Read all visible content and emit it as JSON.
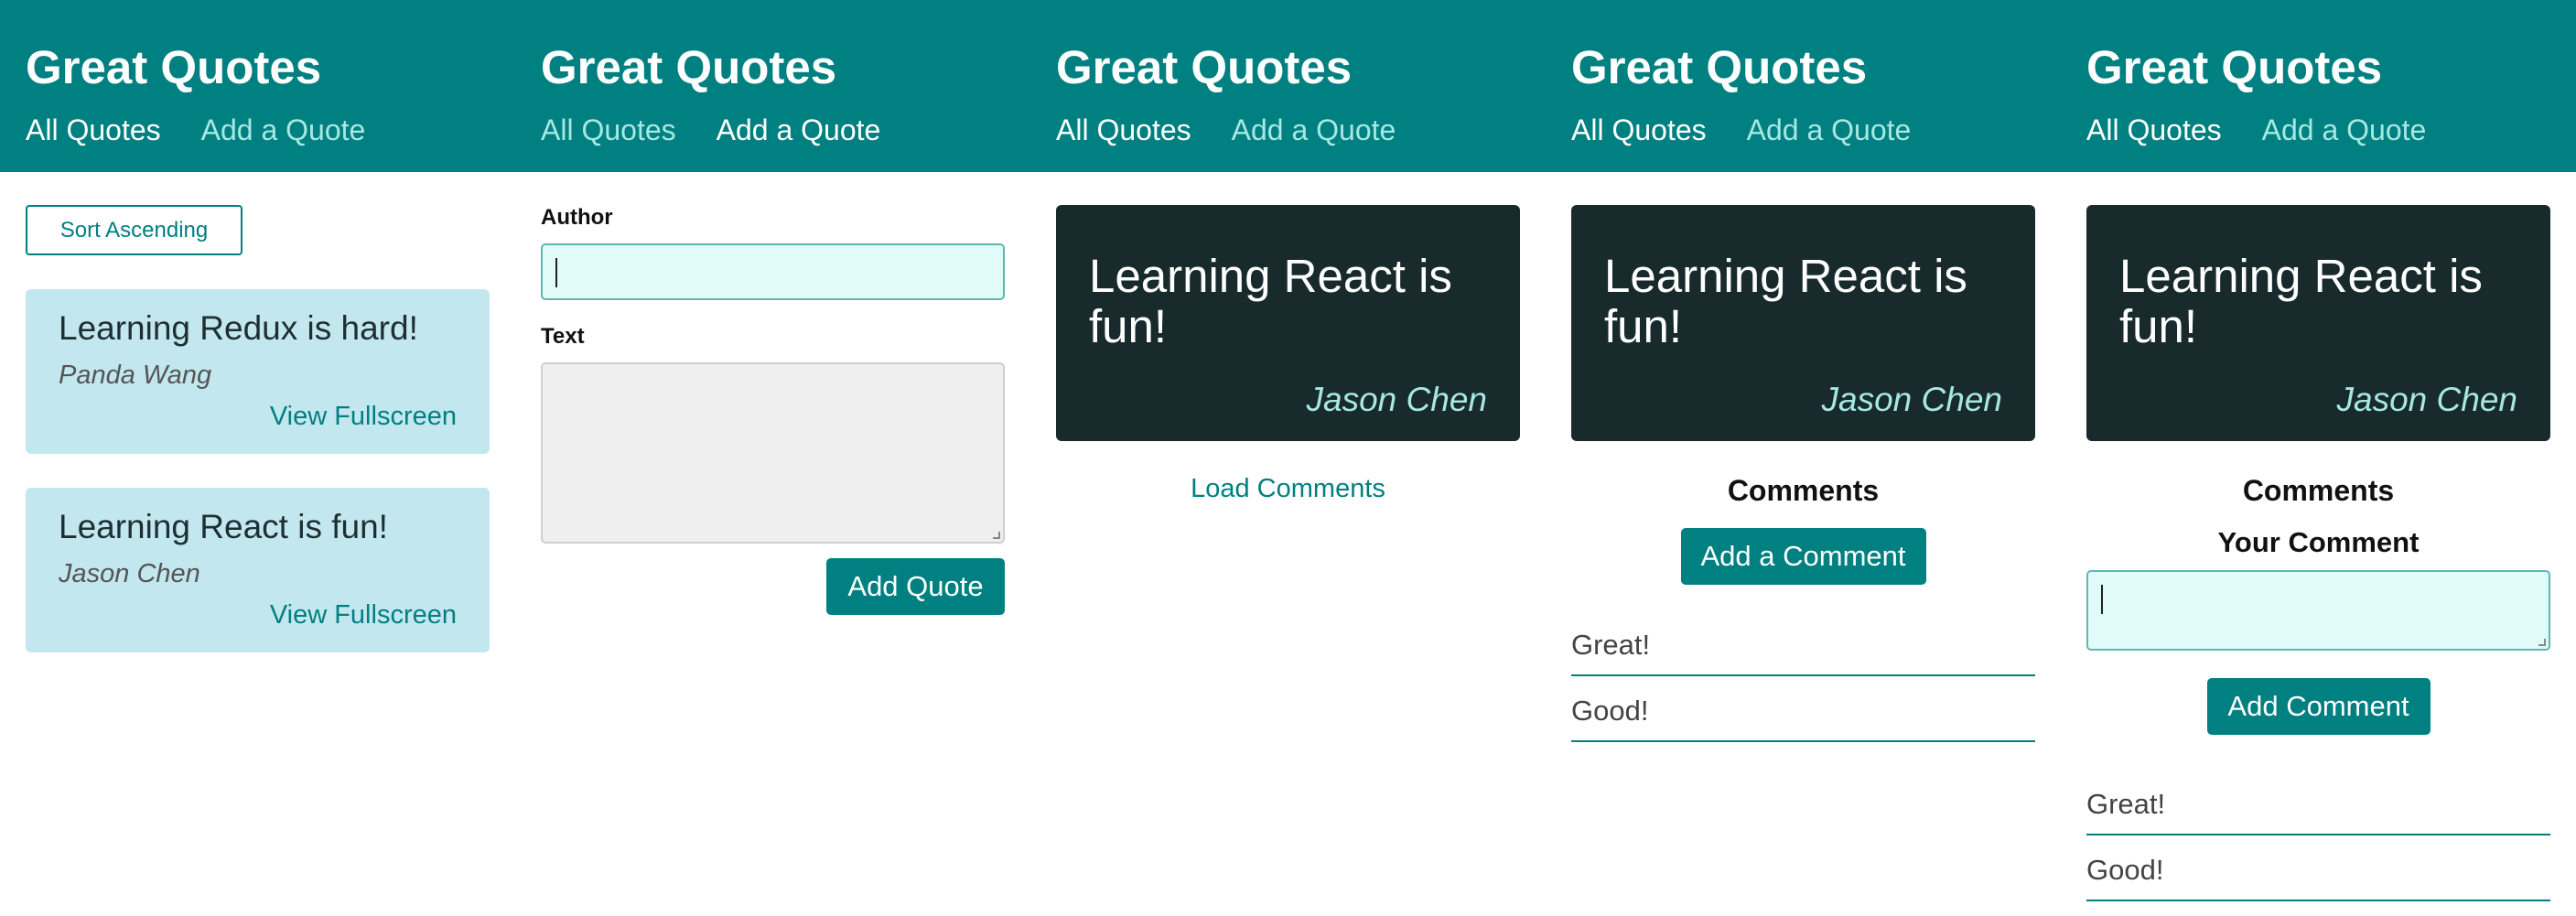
{
  "header": {
    "brand": "Great Quotes",
    "nav": {
      "all_quotes": "All Quotes",
      "add_quote": "Add a Quote"
    },
    "background": "#008080"
  },
  "quotes_list": {
    "sort_label": "Sort Ascending",
    "items": [
      {
        "text": "Learning Redux is hard!",
        "author": "Panda Wang",
        "link": "View Fullscreen"
      },
      {
        "text": "Learning React is fun!",
        "author": "Jason Chen",
        "link": "View Fullscreen"
      }
    ]
  },
  "new_quote_form": {
    "author_label": "Author",
    "author_value": "",
    "text_label": "Text",
    "text_value": "",
    "submit_label": "Add Quote"
  },
  "quote_detail": {
    "text": "Learning React is fun!",
    "author": "Jason Chen",
    "load_comments_label": "Load Comments"
  },
  "comments": {
    "title": "Comments",
    "add_comment_label": "Add a Comment",
    "your_comment_label": "Your Comment",
    "comment_value": "",
    "submit_comment_label": "Add Comment",
    "items": [
      "Great!",
      "Good!"
    ]
  },
  "colors": {
    "teal": "#008080",
    "nav_inactive": "#a7e8e2",
    "quote_card": "#c3e7ef",
    "highlight_card": "#182a2c"
  }
}
